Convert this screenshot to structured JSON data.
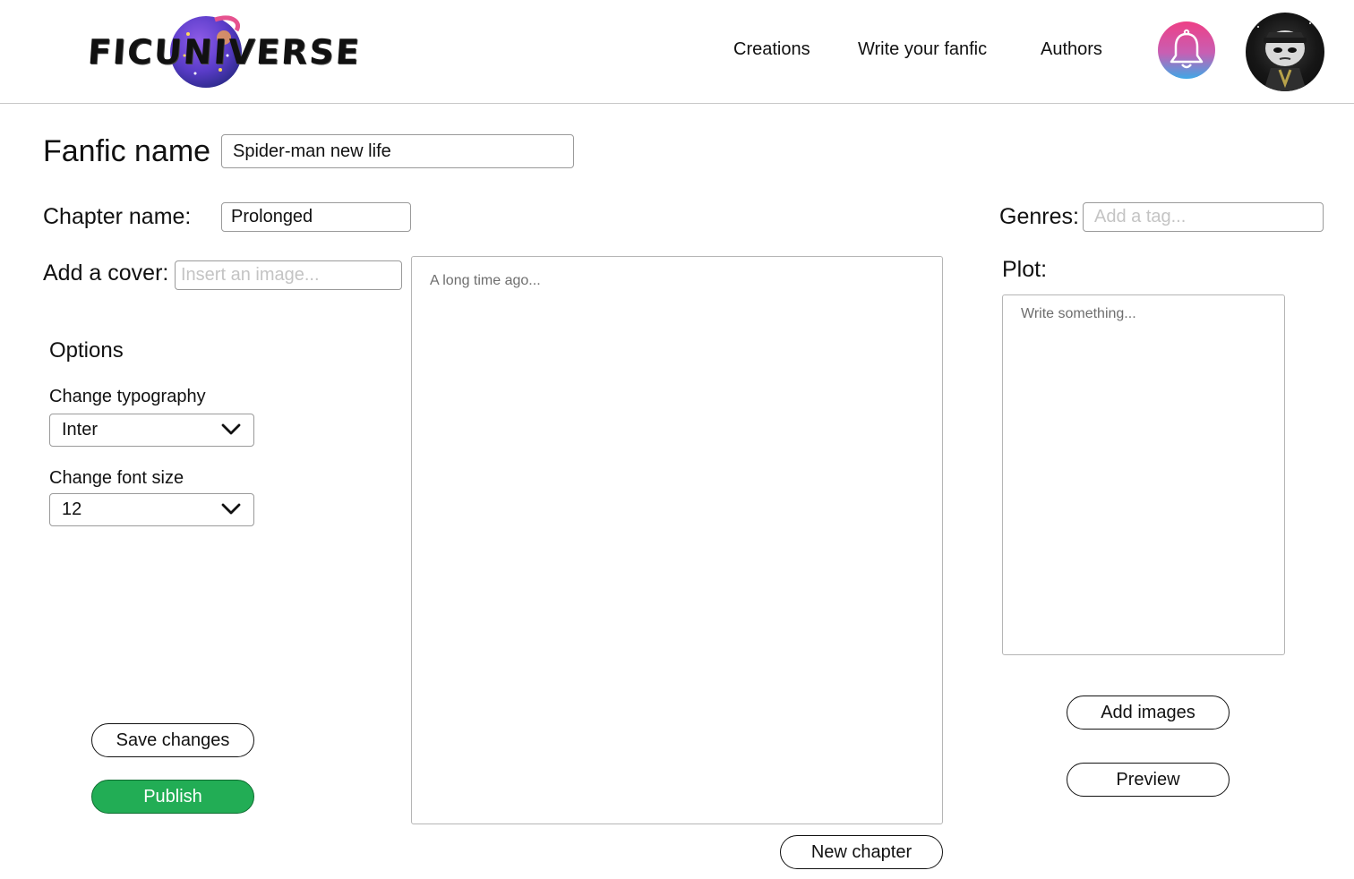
{
  "header": {
    "logo_text": "FICUNIVERSE",
    "nav": {
      "creations": "Creations",
      "write": "Write your fanfic",
      "authors": "Authors"
    },
    "icons": {
      "notifications": "bell-icon",
      "profile": "avatar"
    }
  },
  "form": {
    "fanfic_name": {
      "label": "Fanfic name",
      "value": "Spider-man new life"
    },
    "chapter_name": {
      "label": "Chapter name:",
      "value": "Prolonged"
    },
    "cover": {
      "label": "Add a cover:",
      "placeholder": "Insert an image..."
    },
    "genres": {
      "label": "Genres:",
      "placeholder": "Add a tag..."
    },
    "plot": {
      "label": "Plot:",
      "placeholder": "Write something..."
    },
    "story": {
      "placeholder": "A long time ago..."
    }
  },
  "options": {
    "title": "Options",
    "typography": {
      "label": "Change typography",
      "value": "Inter"
    },
    "font_size": {
      "label": "Change font size",
      "value": "12"
    }
  },
  "buttons": {
    "save": "Save changes",
    "publish": "Publish",
    "new_chapter": "New chapter",
    "add_images": "Add images",
    "preview": "Preview"
  },
  "colors": {
    "publish": "#22ad55",
    "bell_gradient": [
      "#ee3f86",
      "#c85fb3",
      "#3fa8e6"
    ]
  }
}
